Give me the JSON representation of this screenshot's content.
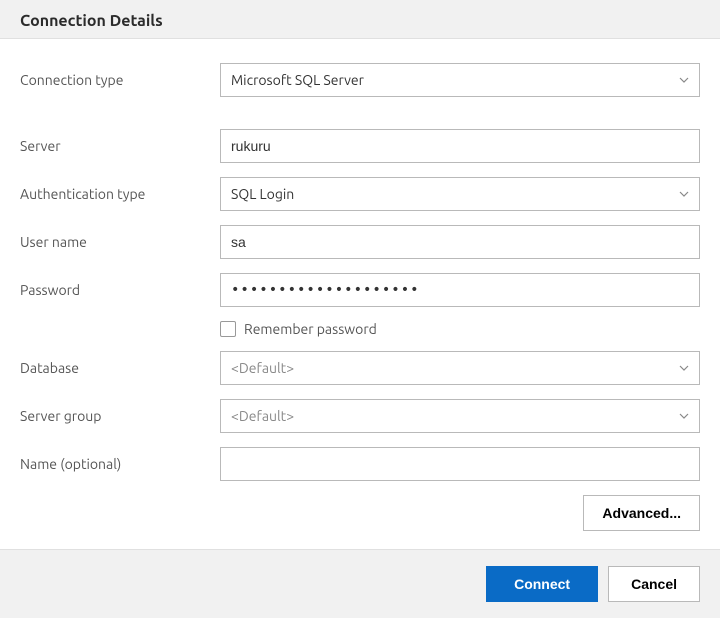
{
  "header": {
    "title": "Connection Details"
  },
  "fields": {
    "connection_type": {
      "label": "Connection type",
      "value": "Microsoft SQL Server"
    },
    "server": {
      "label": "Server",
      "value": "rukuru"
    },
    "auth_type": {
      "label": "Authentication type",
      "value": "SQL Login"
    },
    "username": {
      "label": "User name",
      "value": "sa"
    },
    "password": {
      "label": "Password",
      "value": "••••••••••••••••••••"
    },
    "remember": {
      "label": "Remember password",
      "checked": false
    },
    "database": {
      "label": "Database",
      "value": "<Default>"
    },
    "server_group": {
      "label": "Server group",
      "value": "<Default>"
    },
    "name": {
      "label": "Name (optional)",
      "value": ""
    }
  },
  "buttons": {
    "advanced": "Advanced...",
    "connect": "Connect",
    "cancel": "Cancel"
  }
}
